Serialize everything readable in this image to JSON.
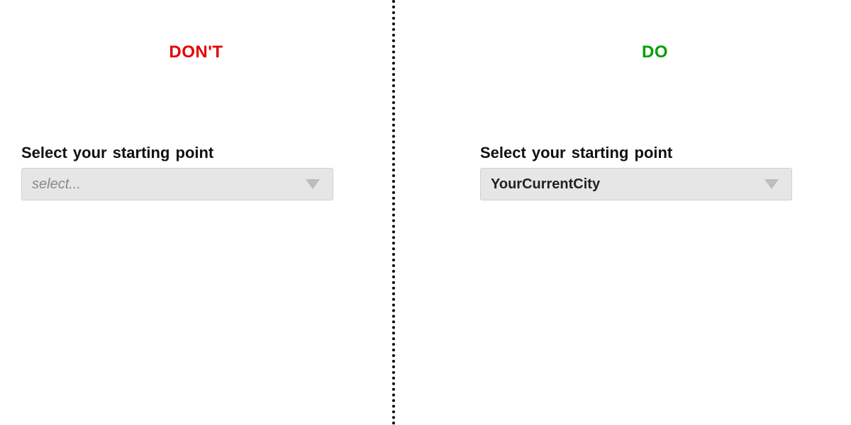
{
  "left": {
    "heading": "DON'T",
    "label": "Select your starting  point",
    "dropdown": {
      "placeholder": "select...",
      "value": ""
    }
  },
  "right": {
    "heading": "DO",
    "label": "Select your starting  point",
    "dropdown": {
      "value": "YourCurrentCity"
    }
  },
  "colors": {
    "dont": "#e60000",
    "do": "#00a000"
  }
}
